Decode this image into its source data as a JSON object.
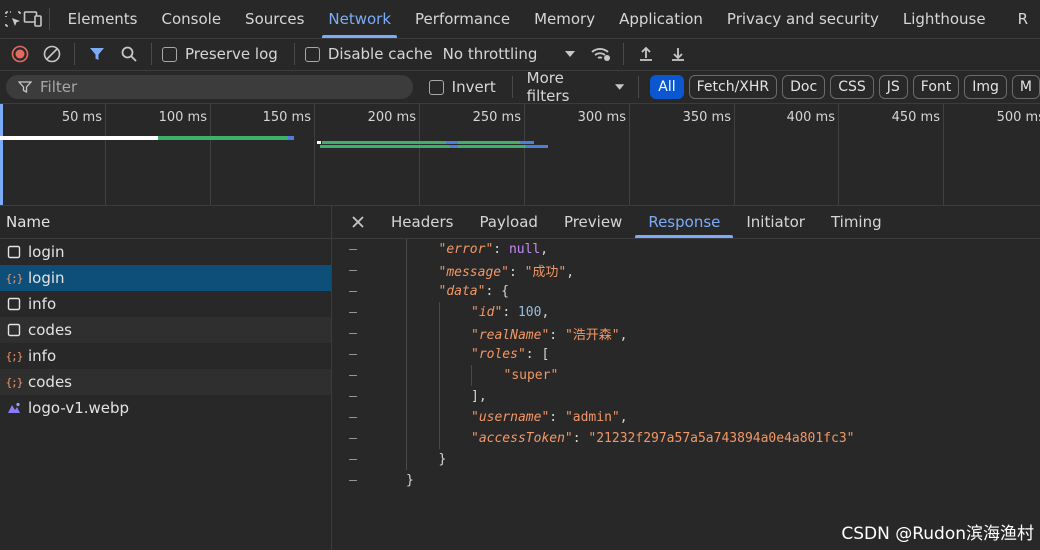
{
  "tabs": [
    "Elements",
    "Console",
    "Sources",
    "Network",
    "Performance",
    "Memory",
    "Application",
    "Privacy and security",
    "Lighthouse",
    "R"
  ],
  "active_tab": "Network",
  "toolbar": {
    "preserve_log": "Preserve log",
    "disable_cache": "Disable cache",
    "throttling": "No throttling"
  },
  "filter": {
    "placeholder": "Filter",
    "invert": "Invert",
    "more_filters": "More filters",
    "types": [
      "All",
      "Fetch/XHR",
      "Doc",
      "CSS",
      "JS",
      "Font",
      "Img",
      "M"
    ]
  },
  "overview": {
    "ticks": [
      "50 ms",
      "100 ms",
      "150 ms",
      "200 ms",
      "250 ms",
      "300 ms",
      "350 ms",
      "400 ms",
      "450 ms",
      "500 ms"
    ]
  },
  "requests": {
    "header": "Name",
    "items": [
      {
        "name": "login",
        "kind": "doc"
      },
      {
        "name": "login",
        "kind": "xhr"
      },
      {
        "name": "info",
        "kind": "doc"
      },
      {
        "name": "codes",
        "kind": "doc"
      },
      {
        "name": "info",
        "kind": "xhr"
      },
      {
        "name": "codes",
        "kind": "xhr"
      },
      {
        "name": "logo-v1.webp",
        "kind": "img"
      }
    ]
  },
  "detail": {
    "tabs": [
      "Headers",
      "Payload",
      "Preview",
      "Response",
      "Initiator",
      "Timing"
    ],
    "active": "Response",
    "gutter_mark": "–",
    "lines": [
      {
        "indent": 1,
        "key": "error",
        "value": "null",
        "vtype": "kw",
        "comma": true
      },
      {
        "indent": 1,
        "key": "message",
        "value": "\"成功\"",
        "vtype": "s",
        "comma": true
      },
      {
        "indent": 1,
        "key": "data",
        "open": "{"
      },
      {
        "indent": 2,
        "key": "id",
        "value": "100",
        "vtype": "n",
        "comma": true
      },
      {
        "indent": 2,
        "key": "realName",
        "value": "\"浩开森\"",
        "vtype": "s",
        "comma": true
      },
      {
        "indent": 2,
        "key": "roles",
        "open": "["
      },
      {
        "indent": 3,
        "value": "\"super\"",
        "vtype": "s"
      },
      {
        "indent": 2,
        "close": "],"
      },
      {
        "indent": 2,
        "key": "username",
        "value": "\"admin\"",
        "vtype": "s",
        "comma": true
      },
      {
        "indent": 2,
        "key": "accessToken",
        "value": "\"21232f297a57a5a743894a0e4a801fc3\"",
        "vtype": "s"
      },
      {
        "indent": 1,
        "close": "}"
      },
      {
        "indent": 0,
        "close": "}"
      }
    ]
  },
  "watermark": "CSDN @Rudon滨海渔村"
}
